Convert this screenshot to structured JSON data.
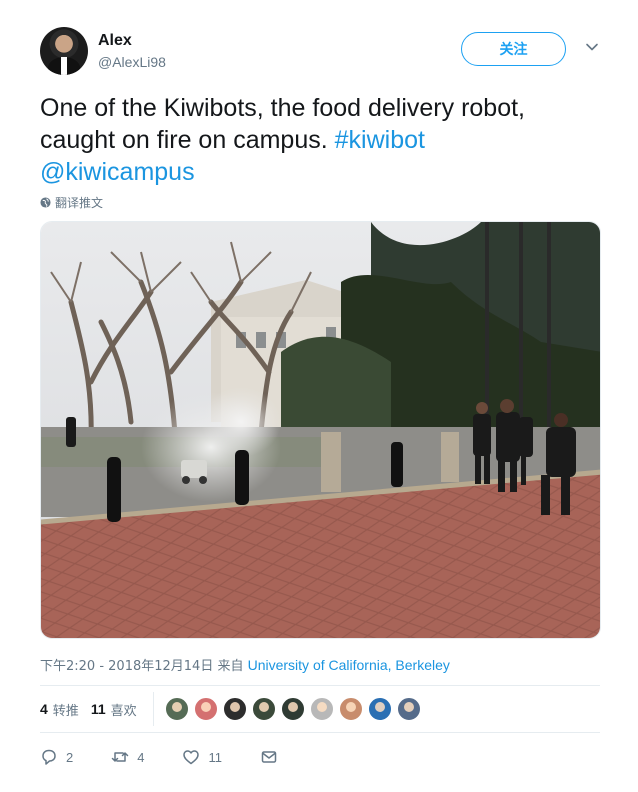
{
  "user": {
    "name": "Alex",
    "handle": "@AlexLi98",
    "follow_label": "关注"
  },
  "tweet": {
    "text": "One of the Kiwibots, the food delivery robot, caught on fire on campus. ",
    "hashtag": "#kiwibot",
    "mention": "@kiwicampus",
    "translate_label": "翻译推文"
  },
  "meta": {
    "timestamp": "下午2:20 - 2018年12月14日",
    "from_label": " 来自 ",
    "location": "University of California, Berkeley"
  },
  "stats": {
    "retweets_count": "4",
    "retweets_label": "转推",
    "likes_count": "11",
    "likes_label": "喜欢",
    "liker_colors": [
      "#556b55",
      "#d47070",
      "#2d2d2d",
      "#3b4a3a",
      "#2f3b33",
      "#b8b8b8",
      "#c88c6c",
      "#2a6fb3",
      "#556b8a"
    ]
  },
  "actions": {
    "reply_count": "2",
    "retweet_count": "4",
    "like_count": "11"
  },
  "colors": {
    "accent": "#1da1f2",
    "link": "#1b95e0",
    "muted": "#657786"
  }
}
